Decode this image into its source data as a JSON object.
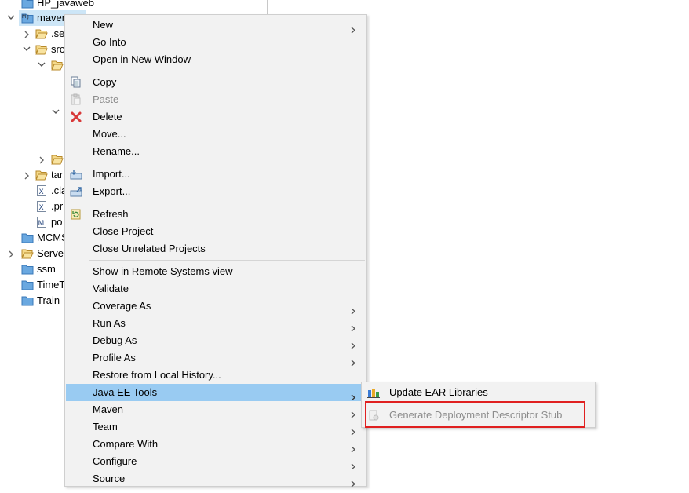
{
  "tree": {
    "items": [
      {
        "label": "HP_javaweb",
        "icon": "project-folder-icon"
      },
      {
        "label": "maven",
        "icon": "maven-project-icon"
      },
      {
        "label": ".se",
        "icon": "open-folder-icon"
      },
      {
        "label": "src",
        "icon": "open-folder-icon"
      },
      {
        "label": "",
        "icon": "open-folder-icon"
      },
      {
        "label": "",
        "icon": "open-folder-icon"
      },
      {
        "label": "tar",
        "icon": "open-folder-icon"
      },
      {
        "label": ".cla",
        "icon": "xml-file-icon"
      },
      {
        "label": ".pr",
        "icon": "xml-file-icon"
      },
      {
        "label": "po",
        "icon": "maven-pom-icon"
      },
      {
        "label": "MCMS",
        "icon": "project-folder-icon"
      },
      {
        "label": "Server",
        "icon": "open-folder-icon"
      },
      {
        "label": "ssm",
        "icon": "project-folder-icon"
      },
      {
        "label": "TimeT",
        "icon": "project-folder-icon"
      },
      {
        "label": "Train",
        "icon": "project-folder-icon"
      }
    ]
  },
  "menu": {
    "items": [
      {
        "label": "New",
        "icon": ""
      },
      {
        "label": "Go Into",
        "icon": ""
      },
      {
        "label": "Open in New Window",
        "icon": ""
      },
      {
        "label": "Copy",
        "icon": "copy-icon"
      },
      {
        "label": "Paste",
        "icon": "paste-icon"
      },
      {
        "label": "Delete",
        "icon": "delete-icon"
      },
      {
        "label": "Move...",
        "icon": ""
      },
      {
        "label": "Rename...",
        "icon": ""
      },
      {
        "label": "Import...",
        "icon": "import-icon"
      },
      {
        "label": "Export...",
        "icon": "export-icon"
      },
      {
        "label": "Refresh",
        "icon": "refresh-icon"
      },
      {
        "label": "Close Project",
        "icon": ""
      },
      {
        "label": "Close Unrelated Projects",
        "icon": ""
      },
      {
        "label": "Show in Remote Systems view",
        "icon": ""
      },
      {
        "label": "Validate",
        "icon": ""
      },
      {
        "label": "Coverage As",
        "icon": ""
      },
      {
        "label": "Run As",
        "icon": ""
      },
      {
        "label": "Debug As",
        "icon": ""
      },
      {
        "label": "Profile As",
        "icon": ""
      },
      {
        "label": "Restore from Local History...",
        "icon": ""
      },
      {
        "label": "Java EE Tools",
        "icon": ""
      },
      {
        "label": "Maven",
        "icon": ""
      },
      {
        "label": "Team",
        "icon": ""
      },
      {
        "label": "Compare With",
        "icon": ""
      },
      {
        "label": "Configure",
        "icon": ""
      },
      {
        "label": "Source",
        "icon": ""
      }
    ]
  },
  "submenu": {
    "items": [
      {
        "label": "Update EAR Libraries",
        "icon": "ear-libraries-icon"
      },
      {
        "label": "Generate Deployment Descriptor Stub",
        "icon": "deployment-descriptor-icon"
      }
    ]
  },
  "colors": {
    "highlight": "#99cbf2",
    "selection": "#cde6f7",
    "annotation_box": "#e02020"
  }
}
